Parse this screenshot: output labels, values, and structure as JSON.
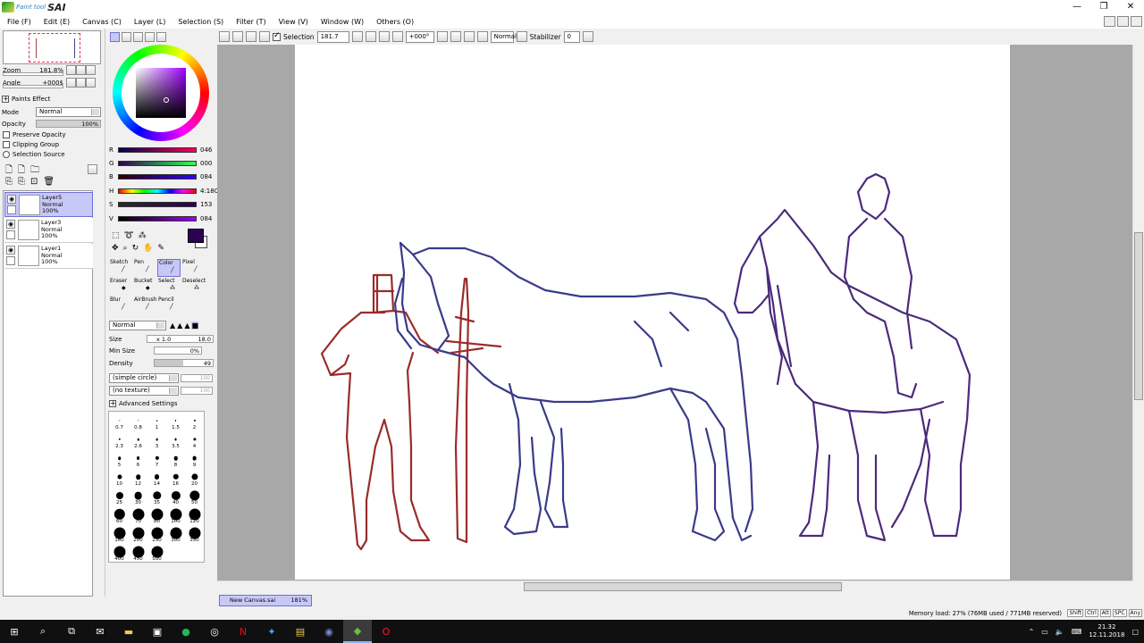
{
  "app": {
    "logo_sub": "Paint tool",
    "logo_main": "SAI",
    "window_controls": [
      "—",
      "❐",
      "✕"
    ]
  },
  "menu": [
    "File (F)",
    "Edit (E)",
    "Canvas (C)",
    "Layer (L)",
    "Selection (S)",
    "Filter (T)",
    "View (V)",
    "Window (W)",
    "Others (O)"
  ],
  "toolbar": {
    "selection_label": "Selection",
    "selection_checked": true,
    "zoom_value": "181.7",
    "angle_value": "+000°",
    "blend_mode": "Normal",
    "stabilizer_label": "Stabilizer",
    "stabilizer_value": "0"
  },
  "navigator": {
    "zoom_label": "Zoom",
    "zoom_value": "181.8%",
    "angle_label": "Angle",
    "angle_value": "+000$"
  },
  "layer_props": {
    "paints_effect": "Paints Effect",
    "mode_label": "Mode",
    "mode_value": "Normal",
    "opacity_label": "Opacity",
    "opacity_value": "100%",
    "preserve_opacity": "Preserve Opacity",
    "clipping_group": "Clipping Group",
    "selection_source": "Selection Source"
  },
  "layers": [
    {
      "name": "Layer5",
      "mode": "Normal",
      "opacity": "100%",
      "active": true
    },
    {
      "name": "Layer3",
      "mode": "Normal",
      "opacity": "100%",
      "active": false
    },
    {
      "name": "Layer1",
      "mode": "Normal",
      "opacity": "100%",
      "active": false
    }
  ],
  "color": {
    "current": "#2e0054",
    "sliders": [
      {
        "label": "R",
        "value": "046",
        "gradient": "linear-gradient(to right,#000054,#ff0054)"
      },
      {
        "label": "G",
        "value": "000",
        "gradient": "linear-gradient(to right,#2e0054,#2eff54)"
      },
      {
        "label": "B",
        "value": "084",
        "gradient": "linear-gradient(to right,#2e0000,#2e00ff)"
      },
      {
        "label": "H",
        "value": "4:180",
        "gradient": "linear-gradient(to right,#f00,#ff0,#0f0,#0ff,#00f,#f0f,#f00)"
      },
      {
        "label": "S",
        "value": "153",
        "gradient": "linear-gradient(to right,#2a2a2a,#2e0054)"
      },
      {
        "label": "V",
        "value": "084",
        "gradient": "linear-gradient(to right,#000,#a000ff)"
      }
    ]
  },
  "tools": [
    {
      "label": "Sketch",
      "active": false
    },
    {
      "label": "Pen",
      "active": false
    },
    {
      "label": "Color",
      "active": true
    },
    {
      "label": "Pixel",
      "active": false
    },
    {
      "label": "Eraser",
      "active": false
    },
    {
      "label": "Bucket",
      "active": false
    },
    {
      "label": "Select",
      "active": false
    },
    {
      "label": "Deselect",
      "active": false
    },
    {
      "label": "Blur",
      "active": false
    },
    {
      "label": "AirBrush",
      "active": false
    },
    {
      "label": "Pencil",
      "active": false
    }
  ],
  "brush": {
    "blend": "Normal",
    "size_label": "Size",
    "size_mult": "x 1.0",
    "size_value": "18.0",
    "min_size_label": "Min Size",
    "min_size_value": "0%",
    "density_label": "Density",
    "density_value": "49",
    "shape": "(simple circle)",
    "shape_value": "100",
    "texture": "(no texture)",
    "texture_value": "100",
    "advanced": "Advanced Settings",
    "sizes": [
      "0.7",
      "0.8",
      "1",
      "1.5",
      "2",
      "2.3",
      "2.6",
      "3",
      "3.5",
      "4",
      "5",
      "6",
      "7",
      "8",
      "9",
      "10",
      "12",
      "14",
      "16",
      "20",
      "25",
      "30",
      "35",
      "40",
      "50",
      "60",
      "70",
      "80",
      "100",
      "120",
      "160",
      "200",
      "250",
      "300",
      "350",
      "400",
      "450",
      "500"
    ]
  },
  "document": {
    "tab_name": "New Canvas.sai",
    "tab_zoom": "181%"
  },
  "status": {
    "memory": "Memory load: 27% (76MB used / 771MB reserved)",
    "keys": [
      "Shift",
      "Ctrl",
      "Alt",
      "SPC",
      "Any"
    ]
  },
  "taskbar": {
    "time": "21.32",
    "date": "12.11.2018"
  }
}
